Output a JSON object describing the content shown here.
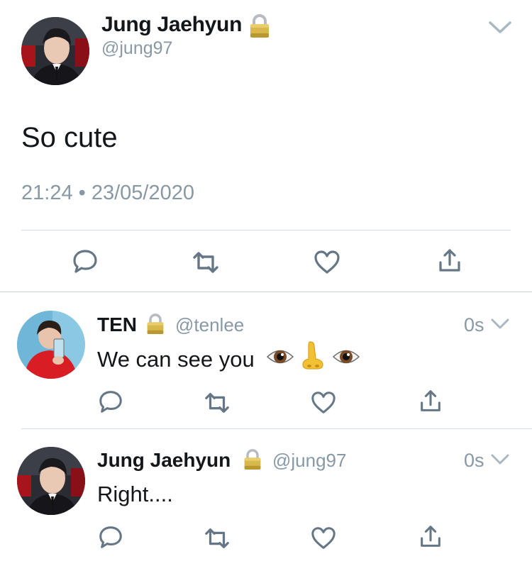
{
  "main_tweet": {
    "author_name": "Jung Jaehyun",
    "handle": "@jung97",
    "text": "So cute",
    "timestamp": "21:24 • 23/05/2020",
    "protected_icon": "lock-icon",
    "menu_icon": "chevron-down-icon",
    "actions": [
      "reply-icon",
      "retweet-icon",
      "like-icon",
      "share-icon"
    ]
  },
  "replies": [
    {
      "author_name": "TEN",
      "handle": "@tenlee",
      "time": "0s",
      "text": "We can see you",
      "emoji": [
        "eye-icon",
        "nose-icon",
        "eye-icon"
      ],
      "protected_icon": "lock-icon"
    },
    {
      "author_name": "Jung Jaehyun",
      "handle": "@jung97",
      "time": "0s",
      "text": "Right....",
      "protected_icon": "lock-icon"
    }
  ],
  "colors": {
    "text": "#14171a",
    "secondary": "#8899a6",
    "icon": "#657786",
    "divider": "#d5dce2"
  }
}
